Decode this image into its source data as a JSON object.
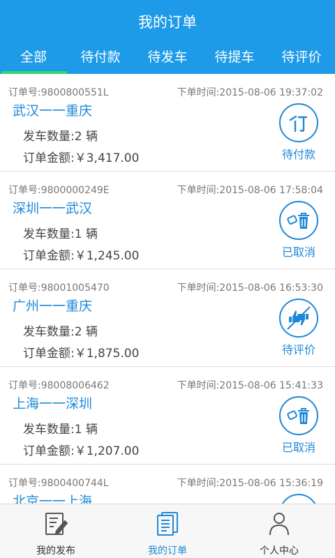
{
  "header": {
    "title": "我的订单"
  },
  "tabs": [
    {
      "label": "全部"
    },
    {
      "label": "待付款"
    },
    {
      "label": "待发车"
    },
    {
      "label": "待提车"
    },
    {
      "label": "待评价"
    }
  ],
  "orders": [
    {
      "no": "订单号:9800800551L",
      "time": "下单时间:2015-08-06 19:37:02",
      "route": "武汉一一重庆",
      "qty": "发车数量:2 辆",
      "amount": "订单金额:￥3,417.00",
      "status": "待付款",
      "icon": "pay-icon"
    },
    {
      "no": "订单号:9800000249E",
      "time": "下单时间:2015-08-06 17:58:04",
      "route": "深圳一一武汉",
      "qty": "发车数量:1 辆",
      "amount": "订单金额:￥1,245.00",
      "status": "已取消",
      "icon": "trash-icon"
    },
    {
      "no": "订单号:98001005470",
      "time": "下单时间:2015-08-06 16:53:30",
      "route": "广州一一重庆",
      "qty": "发车数量:2 辆",
      "amount": "订单金额:￥1,875.00",
      "status": "待评价",
      "icon": "thumbs-icon"
    },
    {
      "no": "订单号:98008006462",
      "time": "下单时间:2015-08-06 15:41:33",
      "route": "上海一一深圳",
      "qty": "发车数量:1 辆",
      "amount": "订单金额:￥1,207.00",
      "status": "已取消",
      "icon": "trash-icon"
    },
    {
      "no": "订单号:9800400744L",
      "time": "下单时间:2015-08-06 15:36:19",
      "route": "北京一一上海"
    }
  ],
  "bottom_nav": [
    {
      "label": "我的发布",
      "icon": "publish-icon"
    },
    {
      "label": "我的订单",
      "icon": "orders-icon",
      "active": true
    },
    {
      "label": "个人中心",
      "icon": "user-icon"
    }
  ],
  "colors": {
    "primary": "#1e9be8",
    "accent": "#1e88d8",
    "tab_indicator": "#2fd86e"
  }
}
